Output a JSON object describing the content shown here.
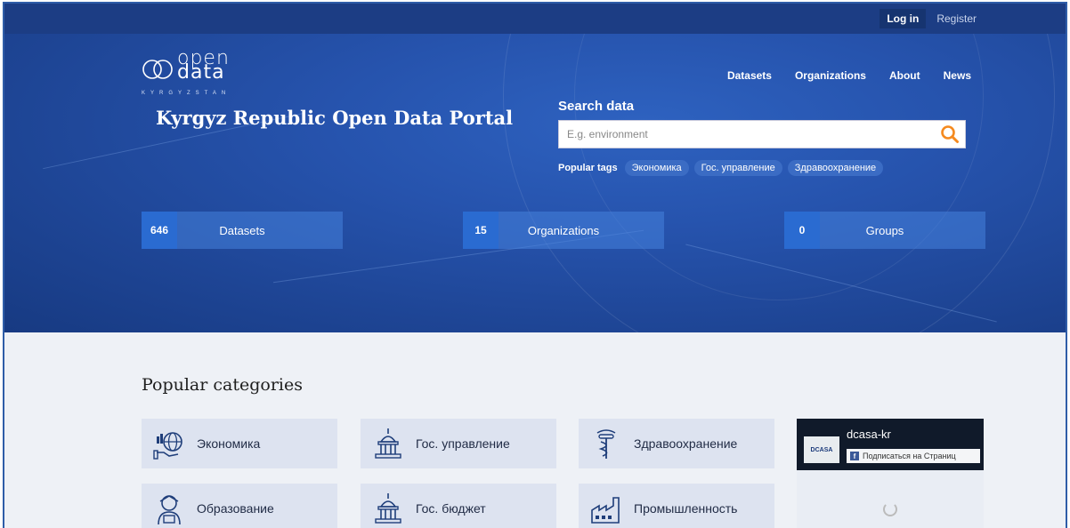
{
  "topbar": {
    "login": "Log in",
    "register": "Register"
  },
  "logo": {
    "word1": "open",
    "word2": "data",
    "country": "KYRGYZSTAN"
  },
  "site_title": "Kyrgyz Republic Open Data Portal",
  "nav": [
    "Datasets",
    "Organizations",
    "About",
    "News"
  ],
  "search": {
    "label": "Search data",
    "placeholder": "E.g. environment",
    "icon": "search-icon"
  },
  "popular_tags": {
    "label": "Popular tags",
    "tags": [
      "Экономика",
      "Гос. управление",
      "Здравоохранение"
    ]
  },
  "stats": [
    {
      "value": "646",
      "label": "Datasets"
    },
    {
      "value": "15",
      "label": "Organizations"
    },
    {
      "value": "0",
      "label": "Groups"
    }
  ],
  "categories_title": "Popular categories",
  "categories": [
    {
      "label": "Экономика",
      "icon": "economy-globe-icon"
    },
    {
      "label": "Гос. управление",
      "icon": "capitol-icon"
    },
    {
      "label": "Здравоохранение",
      "icon": "caduceus-icon"
    },
    {
      "label": "Образование",
      "icon": "student-icon"
    },
    {
      "label": "Гос. бюджет",
      "icon": "capitol-icon"
    },
    {
      "label": "Промышленность",
      "icon": "factory-icon"
    }
  ],
  "facebook": {
    "page_name": "dcasa-kr",
    "thumb_text": "DCASA",
    "subscribe": "Подписаться на Страниц"
  },
  "colors": {
    "accent": "#f58a1f",
    "hero": "#2653ad",
    "topbar": "#1c3d84",
    "stat_num": "#2a6bd1"
  }
}
